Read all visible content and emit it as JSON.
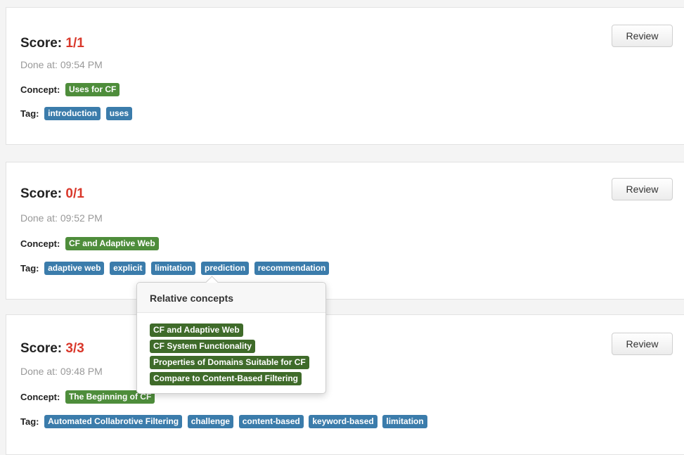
{
  "cards": [
    {
      "score_label": "Score:",
      "score_value": "1/1",
      "done_at": "Done at: 09:54 PM",
      "concept_label": "Concept:",
      "concepts": [
        "Uses for CF"
      ],
      "tag_label": "Tag:",
      "tags": [
        "introduction",
        "uses"
      ],
      "review_label": "Review"
    },
    {
      "score_label": "Score:",
      "score_value": "0/1",
      "done_at": "Done at: 09:52 PM",
      "concept_label": "Concept:",
      "concepts": [
        "CF and Adaptive Web"
      ],
      "tag_label": "Tag:",
      "tags": [
        "adaptive web",
        "explicit",
        "limitation",
        "prediction",
        "recommendation"
      ],
      "review_label": "Review"
    },
    {
      "score_label": "Score:",
      "score_value": "3/3",
      "done_at": "Done at: 09:48 PM",
      "concept_label": "Concept:",
      "concepts": [
        "The Beginning of CF"
      ],
      "tag_label": "Tag:",
      "tags": [
        "Automated Collabrotive Filtering",
        "challenge",
        "content-based",
        "keyword-based",
        "limitation"
      ],
      "review_label": "Review"
    }
  ],
  "popover": {
    "title": "Relative concepts",
    "items": [
      "CF and Adaptive Web",
      "CF System Functionality",
      "Properties of Domains Suitable for CF",
      "Compare to Content-Based Filtering"
    ]
  },
  "colors": {
    "score": "#d9382b",
    "concept_label": "#4e8d3b",
    "tag_label": "#3b7cab",
    "popover_label": "#3f6b2a"
  }
}
